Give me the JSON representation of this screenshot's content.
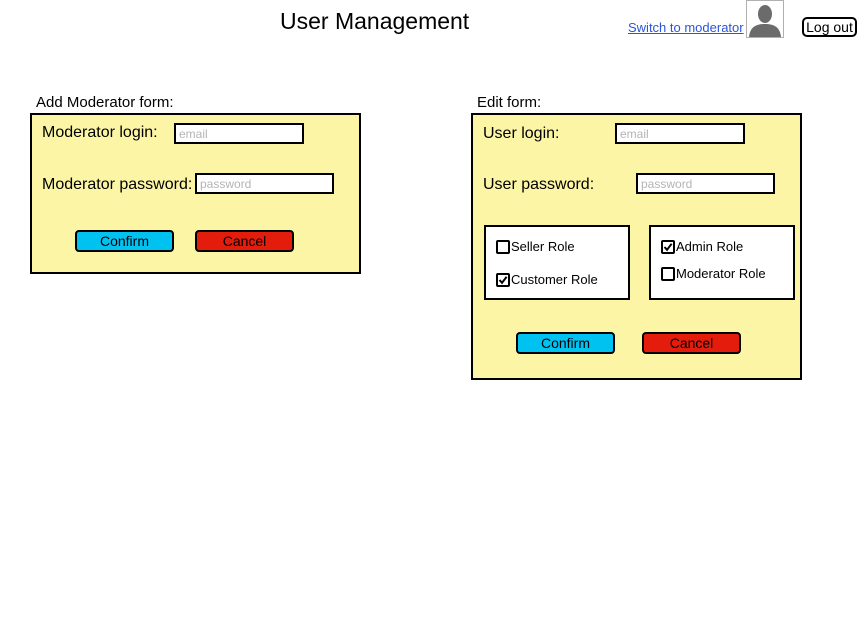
{
  "header": {
    "title": "User Management",
    "switch_link": "Switch to moderator",
    "avatar_icon": "user-silhouette-icon",
    "logout_label": "Log out"
  },
  "add_moderator_form": {
    "title": "Add Moderator form:",
    "login_label": "Moderator login:",
    "login_placeholder": "email",
    "login_value": "",
    "password_label": "Moderator password:",
    "password_placeholder": "password",
    "password_value": "",
    "confirm_label": "Confirm",
    "cancel_label": "Cancel"
  },
  "edit_form": {
    "title": "Edit form:",
    "login_label": "User login:",
    "login_placeholder": "email",
    "login_value": "",
    "password_label": "User password:",
    "password_placeholder": "password",
    "password_value": "",
    "roles_left": [
      {
        "label": "Seller Role",
        "checked": false
      },
      {
        "label": "Customer Role",
        "checked": true
      }
    ],
    "roles_right": [
      {
        "label": "Admin Role",
        "checked": true
      },
      {
        "label": "Moderator Role",
        "checked": false
      }
    ],
    "confirm_label": "Confirm",
    "cancel_label": "Cancel"
  },
  "colors": {
    "panel_background": "#fbf5a5",
    "confirm_button": "#00c2f1",
    "cancel_button": "#e31c0c",
    "link": "#2b55d6"
  }
}
